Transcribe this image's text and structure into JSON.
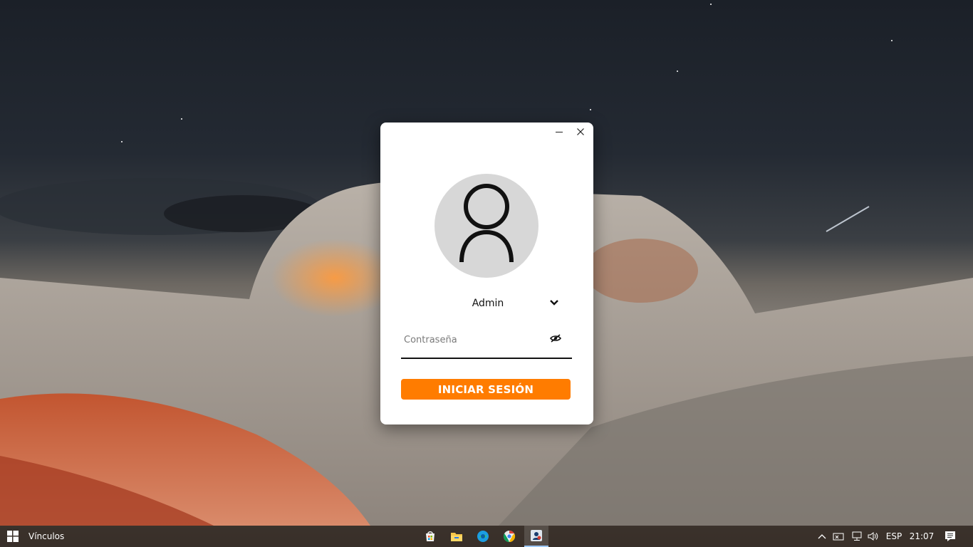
{
  "login": {
    "user_name": "Admin",
    "password_placeholder": "Contraseña",
    "password_value": "",
    "login_button_label": "INICIAR SESIÓN"
  },
  "taskbar": {
    "links_label": "Vínculos",
    "language": "ESP",
    "time": "21:07",
    "apps": [
      "store-icon",
      "file-explorer-icon",
      "edge-icon",
      "chrome-icon",
      "login-app-icon"
    ]
  },
  "colors": {
    "accent": "#ff7c00",
    "avatar_bg": "#d7d7d7",
    "window_bg": "#ffffff"
  }
}
